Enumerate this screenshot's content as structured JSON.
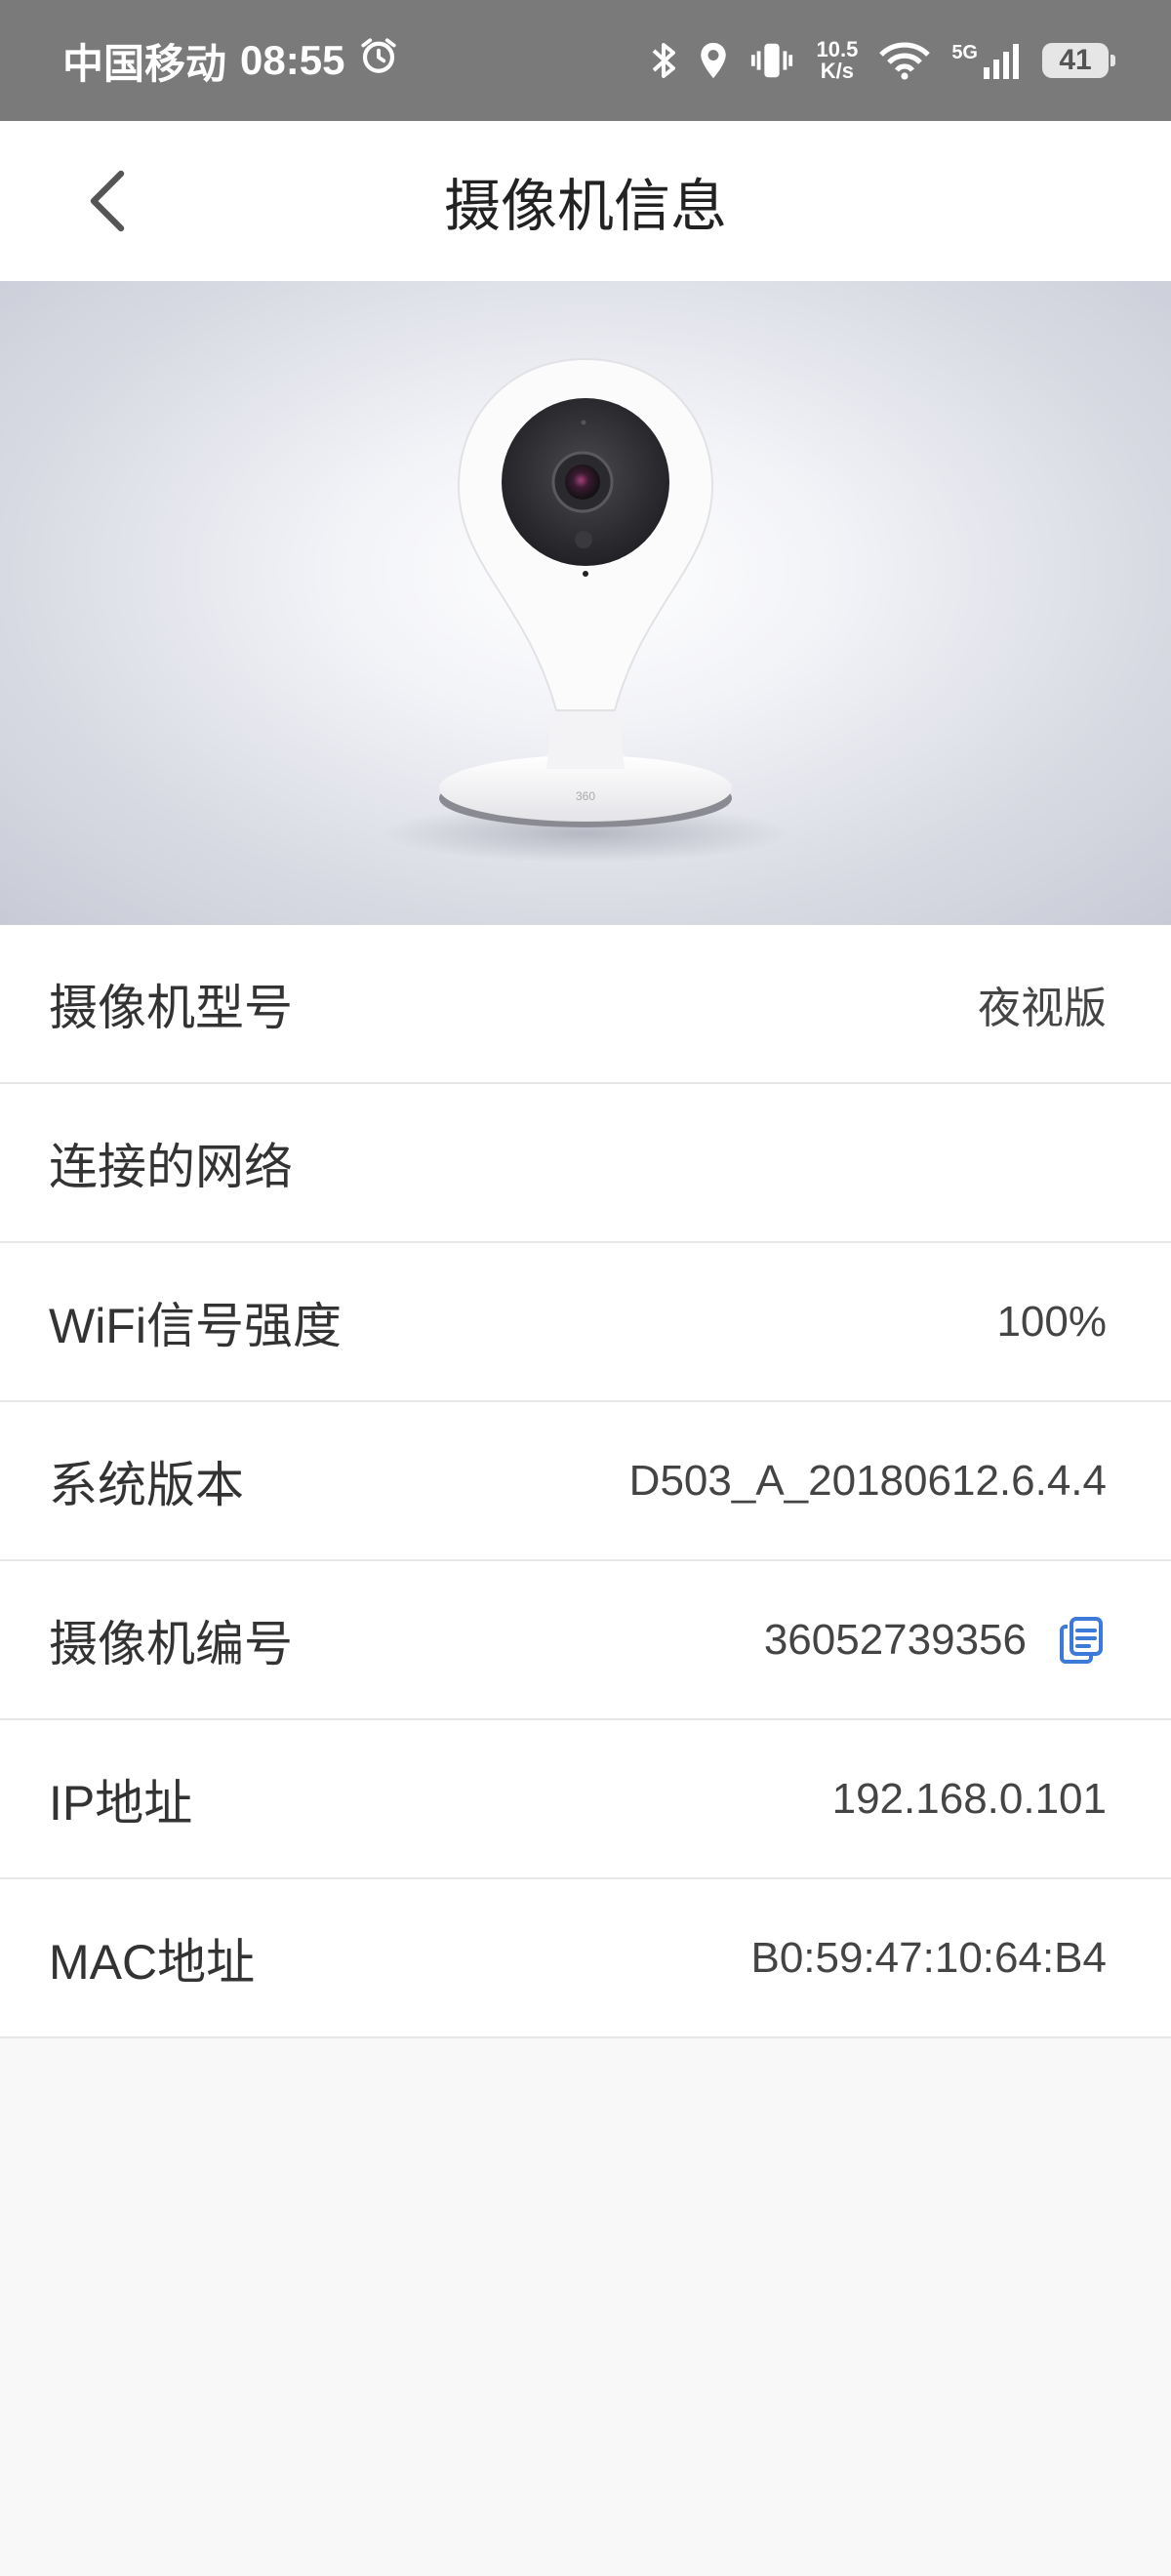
{
  "status_bar": {
    "carrier": "中国移动",
    "time": "08:55",
    "speed_value": "10.5",
    "speed_unit": "K/s",
    "network": "5G",
    "battery": "41"
  },
  "header": {
    "title": "摄像机信息"
  },
  "hero": {
    "brand_mark": "360"
  },
  "info_rows": [
    {
      "label": "摄像机型号",
      "value": "夜视版"
    },
    {
      "label": "连接的网络",
      "value": ""
    },
    {
      "label": "WiFi信号强度",
      "value": "100%"
    },
    {
      "label": "系统版本",
      "value": "D503_A_20180612.6.4.4"
    },
    {
      "label": "摄像机编号",
      "value": "36052739356"
    },
    {
      "label": "IP地址",
      "value": "192.168.0.101"
    },
    {
      "label": "MAC地址",
      "value": "B0:59:47:10:64:B4"
    }
  ],
  "colors": {
    "status_bar_bg": "#7a7a7a",
    "accent_blue": "#3b7ad9",
    "divider": "#e7e7e7"
  },
  "icons": [
    "alarm-icon",
    "bluetooth-icon",
    "location-icon",
    "vibrate-icon",
    "wifi-icon",
    "signal-icon",
    "battery-icon",
    "back-arrow-icon",
    "copy-icon"
  ]
}
